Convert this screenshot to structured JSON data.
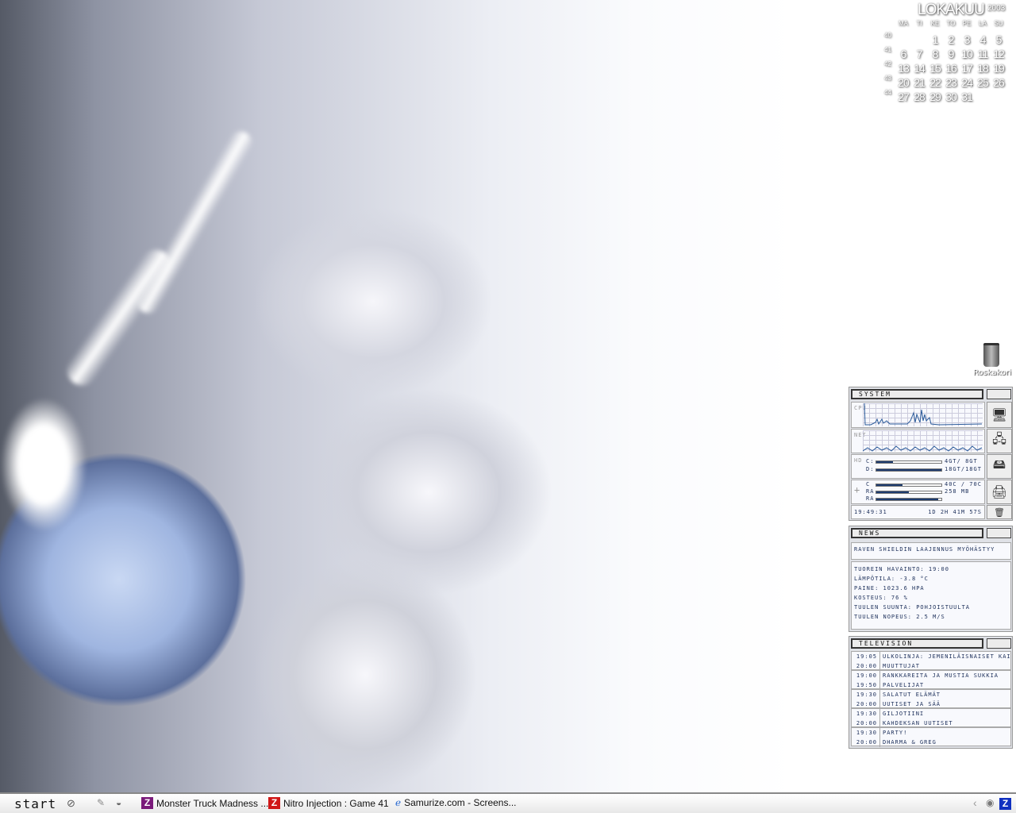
{
  "calendar": {
    "month": "LOKAKUU",
    "year": "2003",
    "weekdays": [
      "MA",
      "TI",
      "KE",
      "TO",
      "PE",
      "LA",
      "SU"
    ],
    "weeks": [
      {
        "no": "40",
        "days": [
          "",
          "",
          "1",
          "2",
          "3",
          "4",
          "5"
        ]
      },
      {
        "no": "41",
        "days": [
          "6",
          "7",
          "8",
          "9",
          "10",
          "11",
          "12"
        ]
      },
      {
        "no": "42",
        "days": [
          "13",
          "14",
          "15",
          "16",
          "17",
          "18",
          "19"
        ]
      },
      {
        "no": "43",
        "days": [
          "20",
          "21",
          "22",
          "23",
          "24",
          "25",
          "26"
        ]
      },
      {
        "no": "44",
        "days": [
          "27",
          "28",
          "29",
          "30",
          "31",
          "",
          ""
        ]
      }
    ],
    "today": "22",
    "today_color": "#d01010"
  },
  "desktop": {
    "trash_label": "Roskakori"
  },
  "system": {
    "title": "SYSTEM",
    "cpu_label": "CPU",
    "net_label": "NET",
    "hd_label": "HD",
    "temp_label": "+",
    "drives": [
      {
        "name": "C:",
        "value": "4GT/ 8GT",
        "fill": 0.25
      },
      {
        "name": "D:",
        "value": "18GT/18GT",
        "fill": 1.0
      }
    ],
    "resources": [
      {
        "name": "C",
        "value": "40C / 70C",
        "fill": 0.4
      },
      {
        "name": "RA",
        "value": "258 MB",
        "fill": 0.5
      },
      {
        "name": "RA",
        "value": "",
        "fill": 0.95
      }
    ],
    "clock": "19:49:31",
    "uptime": "1D 2H 41M 57S"
  },
  "news": {
    "title": "NEWS",
    "headline": "RAVEN SHIELDIN LAAJENNUS MYÖHÄSTYY",
    "weather": [
      "TUOREIN HAVAINTO: 19:00",
      "LÄMPÖTILA: -3.8 °C",
      "PAINE: 1023.6 HPA",
      "KOSTEUS: 76 %",
      "TUULEN SUUNTA: POHJOISTUULTA",
      "TUULEN NOPEUS: 2.5 M/S"
    ]
  },
  "tv": {
    "title": "TELEVISION",
    "programs": [
      {
        "time": "19:05",
        "name": "ULKOLINJA: JEMENILÄISNAISET KAI"
      },
      {
        "time": "20:00",
        "name": "MUUTTUJAT"
      },
      {
        "time": "19:00",
        "name": "RANKKAREITA JA MUSTIA SUKKIA"
      },
      {
        "time": "19:50",
        "name": "PALVELIJAT"
      },
      {
        "time": "19:30",
        "name": "SALATUT ELÄMÄT"
      },
      {
        "time": "20:00",
        "name": "UUTISET JA SÄÄ"
      },
      {
        "time": "19:30",
        "name": "GILJOTIINI"
      },
      {
        "time": "20:00",
        "name": "KAHDEKSAN UUTISET"
      },
      {
        "time": "19:30",
        "name": "PARTY!"
      },
      {
        "time": "20:00",
        "name": "DHARMA & GREG"
      }
    ]
  },
  "taskbar": {
    "start": "start",
    "tasks": [
      "Monster Truck Madness ...",
      "Nitro Injection : Game 41",
      "Samurize.com - Screens..."
    ],
    "z_color_1": "#7a1a7a",
    "z_color_2": "#d01818",
    "tray_z_color": "#1030c0"
  }
}
